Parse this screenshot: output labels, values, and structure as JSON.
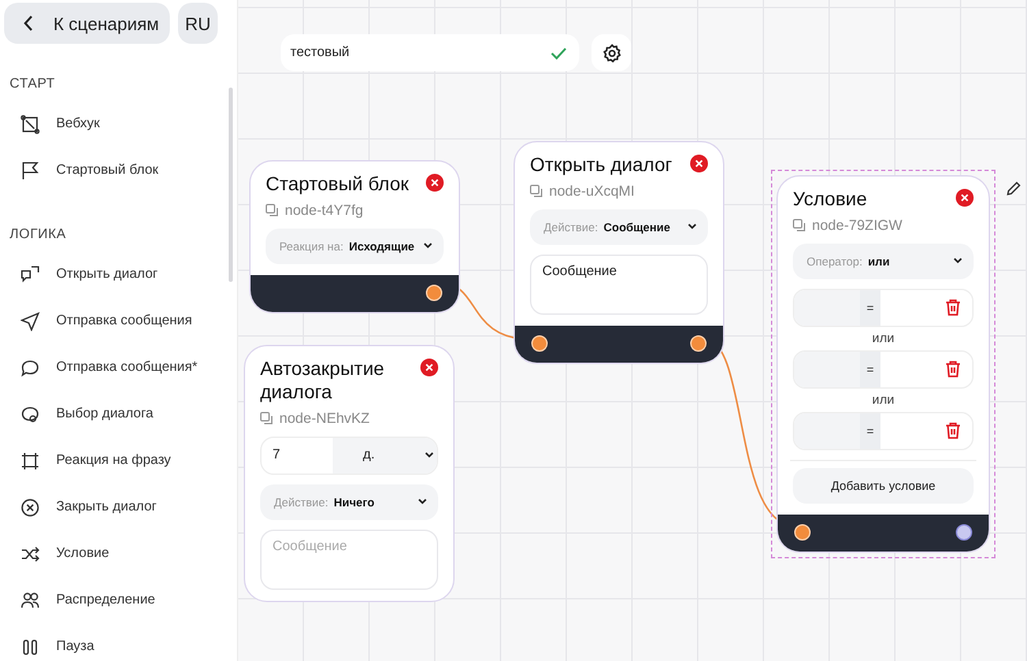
{
  "sidebar": {
    "back_button": "К сценариям",
    "language_button": "RU",
    "sections": [
      {
        "title": "СТАРТ",
        "items": [
          {
            "label": "Вебхук"
          },
          {
            "label": "Стартовый блок"
          }
        ]
      },
      {
        "title": "ЛОГИКА",
        "items": [
          {
            "label": "Открыть диалог"
          },
          {
            "label": "Отправка сообщения"
          },
          {
            "label": "Отправка сообщения*"
          },
          {
            "label": "Выбор диалога"
          },
          {
            "label": "Реакция на фразу"
          },
          {
            "label": "Закрыть диалог"
          },
          {
            "label": "Условие"
          },
          {
            "label": "Распределение"
          },
          {
            "label": "Пауза"
          }
        ]
      }
    ]
  },
  "toolbar": {
    "name_field": {
      "value": "тестовый",
      "valid": true
    }
  },
  "nodes": [
    {
      "title": "Стартовый блок",
      "node_id": "node-t4Y7fg",
      "selected": false,
      "controls": [
        {
          "kind": "select",
          "label": "Реакция на:",
          "value": "Исходящие"
        }
      ],
      "ports": [
        {
          "kind": "output",
          "connected": true
        }
      ]
    },
    {
      "title": "Автозакрытие диалога",
      "node_id": "node-NEhvKZ",
      "selected": false,
      "controls": [
        {
          "kind": "number_unit",
          "value": "7",
          "unit": "д."
        },
        {
          "kind": "select",
          "label": "Действие:",
          "value": "Ничего"
        },
        {
          "kind": "textarea",
          "placeholder": "Сообщение"
        }
      ]
    },
    {
      "title": "Открыть диалог",
      "node_id": "node-uXcqMI",
      "selected": false,
      "controls": [
        {
          "kind": "select",
          "label": "Действие:",
          "value": "Сообщение"
        },
        {
          "kind": "textarea",
          "value": "Сообщение"
        }
      ],
      "ports": [
        {
          "kind": "input",
          "connected": true
        },
        {
          "kind": "output",
          "connected": true
        }
      ]
    },
    {
      "title": "Условие",
      "node_id": "node-79ZIGW",
      "selected": true,
      "controls": [
        {
          "kind": "select",
          "label": "Оператор:",
          "value": "или"
        },
        {
          "kind": "condition",
          "operator": "="
        },
        {
          "kind": "separator",
          "text": "или"
        },
        {
          "kind": "condition",
          "operator": "="
        },
        {
          "kind": "separator",
          "text": "или"
        },
        {
          "kind": "condition",
          "operator": "="
        },
        {
          "kind": "add_button",
          "label": "Добавить условие"
        }
      ],
      "ports": [
        {
          "kind": "input",
          "connected": true
        },
        {
          "kind": "output",
          "connected": false
        }
      ]
    }
  ]
}
